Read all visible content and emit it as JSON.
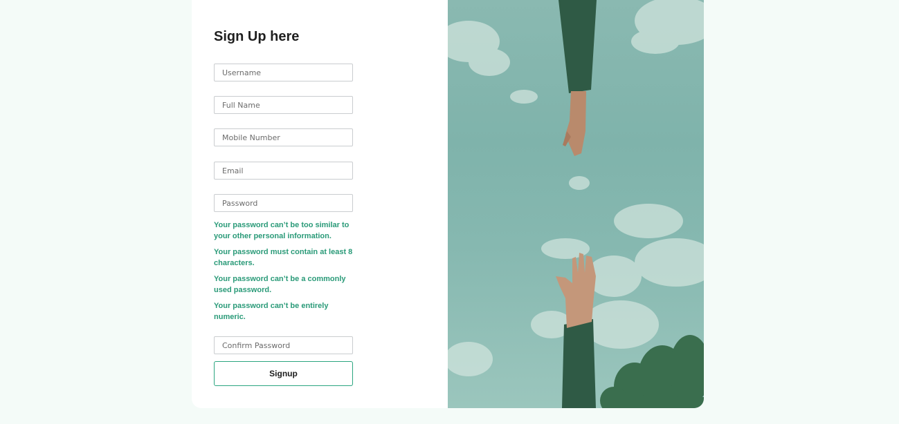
{
  "form": {
    "title": "Sign Up here",
    "fields": {
      "username": {
        "placeholder": "Username",
        "value": ""
      },
      "full_name": {
        "placeholder": "Full Name",
        "value": ""
      },
      "mobile": {
        "placeholder": "Mobile Number",
        "value": ""
      },
      "email": {
        "placeholder": "Email",
        "value": ""
      },
      "password": {
        "placeholder": "Password",
        "value": ""
      },
      "confirm_password": {
        "placeholder": "Confirm Password",
        "value": ""
      }
    },
    "password_help": [
      "Your password can’t be too similar to your other personal information.",
      "Your password must contain at least 8 characters.",
      "Your password can’t be a commonly used password.",
      "Your password can’t be entirely numeric."
    ],
    "submit_label": "Signup"
  },
  "theme": {
    "accent": "#2aa57f",
    "help_text": "#2a9a78",
    "page_background": "#f4fbf8"
  },
  "illustration": {
    "subject": "reaching-hands-sky-photo"
  }
}
